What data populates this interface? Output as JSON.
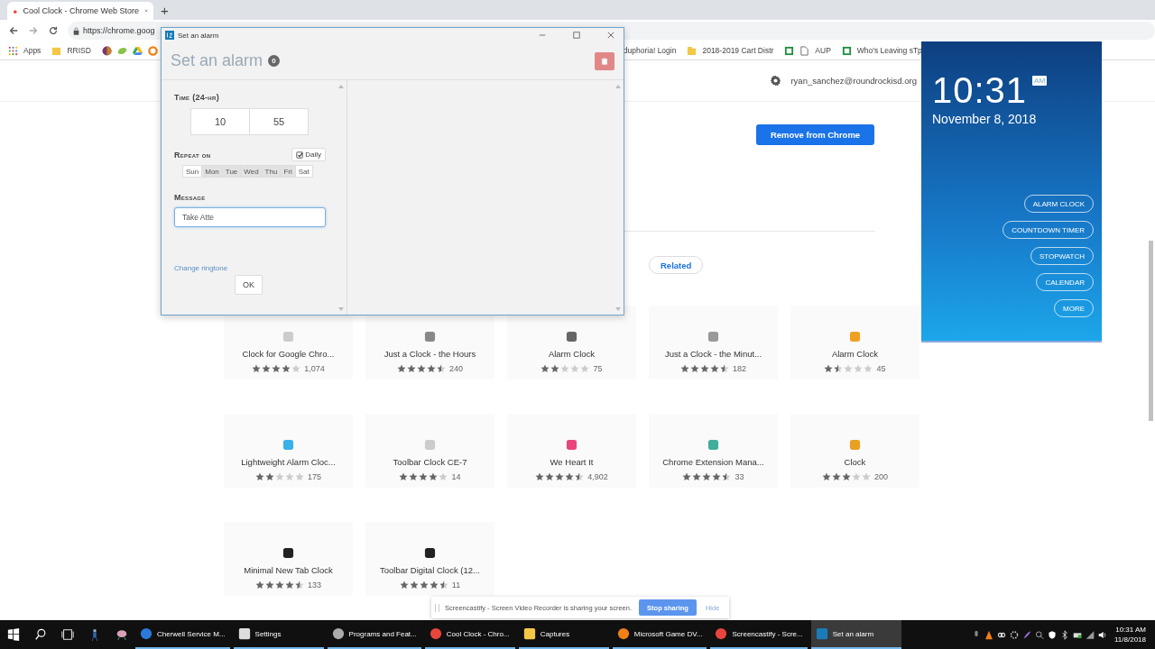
{
  "browser": {
    "tab_title": "Cool Clock - Chrome Web Store",
    "new_tab": "+",
    "url": "https://chrome.goog",
    "bookmarks_left": [
      {
        "label": "Apps"
      },
      {
        "label": "RRISD"
      }
    ],
    "bookmarks_right": [
      {
        "label": "duphoria! Login"
      },
      {
        "label": "2018-2019 Cart Distr"
      },
      {
        "label": "AUP"
      },
      {
        "label": "Who's Leaving sTp"
      }
    ]
  },
  "store": {
    "account": "ryan_sanchez@roundrockisd.org",
    "remove_button": "Remove from Chrome",
    "tabs": [
      {
        "label": "Related",
        "selected": true
      }
    ],
    "cards": [
      {
        "title": "Clock for Google Chro...",
        "stars": 4,
        "count": "1,074"
      },
      {
        "title": "Just a Clock - the Hours",
        "stars": 4.5,
        "count": "240"
      },
      {
        "title": "Alarm Clock",
        "stars": 2,
        "count": "75"
      },
      {
        "title": "Just a Clock - the Minut...",
        "stars": 4.5,
        "count": "182"
      },
      {
        "title": "Alarm Clock",
        "stars": 1.5,
        "count": "45"
      },
      {
        "title": "Lightweight Alarm Cloc...",
        "stars": 2,
        "count": "175"
      },
      {
        "title": "Toolbar Clock CE-7",
        "stars": 4,
        "count": "14"
      },
      {
        "title": "We Heart It",
        "stars": 4.5,
        "count": "4,902"
      },
      {
        "title": "Chrome Extension Mana...",
        "stars": 4.5,
        "count": "33"
      },
      {
        "title": "Clock",
        "stars": 3,
        "count": "200"
      },
      {
        "title": "Minimal New Tab Clock",
        "stars": 4.5,
        "count": "133"
      },
      {
        "title": "Toolbar Digital Clock (12...",
        "stars": 4.5,
        "count": "11"
      }
    ]
  },
  "dialog": {
    "window_title": "Set an alarm",
    "heading": "Set an alarm",
    "badge": "0",
    "time_label": "Time (24-hr)",
    "hours": "10",
    "minutes": "55",
    "repeat_label": "Repeat on",
    "daily": {
      "label": "Daily",
      "checked": true
    },
    "days": [
      {
        "label": "Sun",
        "selected": false
      },
      {
        "label": "Mon",
        "selected": true
      },
      {
        "label": "Tue",
        "selected": true
      },
      {
        "label": "Wed",
        "selected": true
      },
      {
        "label": "Thu",
        "selected": true
      },
      {
        "label": "Fri",
        "selected": true
      },
      {
        "label": "Sat",
        "selected": false
      }
    ],
    "message_label": "Message",
    "message": "Take Atte",
    "ringtone_link": "Change ringtone",
    "ok": "OK"
  },
  "clock": {
    "time": "10:31",
    "ampm": "AM",
    "date": "November 8, 2018",
    "buttons": [
      "ALARM CLOCK",
      "COUNTDOWN TIMER",
      "STOPWATCH",
      "CALENDAR",
      "MORE"
    ]
  },
  "share_bar": {
    "text": "Screencastify - Screen Video Recorder is sharing your screen.",
    "stop": "Stop sharing",
    "hide": "Hide"
  },
  "taskbar": {
    "items": [
      {
        "label": "Cherwell Service M...",
        "selected": false
      },
      {
        "label": "Settings",
        "selected": false
      },
      {
        "label": "Programs and Feat...",
        "selected": false
      },
      {
        "label": "Cool Clock - Chro...",
        "selected": false
      },
      {
        "label": "Captures",
        "selected": false
      },
      {
        "label": "Microsoft Game DV...",
        "selected": false
      },
      {
        "label": "Screencastify - Scre...",
        "selected": false
      },
      {
        "label": "Set an alarm",
        "selected": true
      }
    ],
    "time": "10:31 AM",
    "date": "11/8/2018"
  }
}
